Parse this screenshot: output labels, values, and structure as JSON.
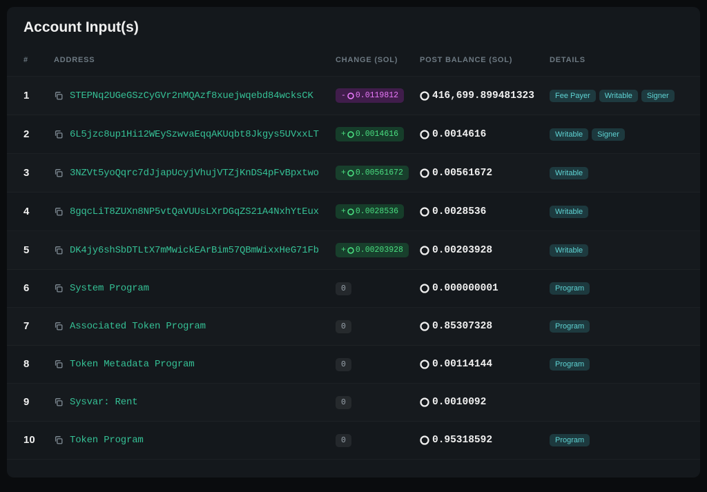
{
  "title": "Account Input(s)",
  "columns": {
    "index": "#",
    "address": "ADDRESS",
    "change": "CHANGE (SOL)",
    "post_balance": "POST BALANCE (SOL)",
    "details": "DETAILS"
  },
  "tags": {
    "fee_payer": "Fee Payer",
    "writable": "Writable",
    "signer": "Signer",
    "program": "Program"
  },
  "rows": [
    {
      "idx": "1",
      "address": "STEPNq2UGeGSzCyGVr2nMQAzf8xuejwqebd84wcksCK",
      "change_sign": "-",
      "change_val": "0.0119812",
      "change_type": "neg",
      "post": "416,699.899481323",
      "details": [
        "fee_payer",
        "writable",
        "signer"
      ]
    },
    {
      "idx": "2",
      "address": "6L5jzc8up1Hi12WEySzwvaEqqAKUqbt8Jkgys5UVxxLT",
      "change_sign": "+",
      "change_val": "0.0014616",
      "change_type": "pos",
      "post": "0.0014616",
      "details": [
        "writable",
        "signer"
      ]
    },
    {
      "idx": "3",
      "address": "3NZVt5yoQqrc7dJjapUcyjVhujVTZjKnDS4pFvBpxtwo",
      "change_sign": "+",
      "change_val": "0.00561672",
      "change_type": "pos",
      "post": "0.00561672",
      "details": [
        "writable"
      ]
    },
    {
      "idx": "4",
      "address": "8gqcLiT8ZUXn8NP5vtQaVUUsLXrDGqZS21A4NxhYtEux",
      "change_sign": "+",
      "change_val": "0.0028536",
      "change_type": "pos",
      "post": "0.0028536",
      "details": [
        "writable"
      ]
    },
    {
      "idx": "5",
      "address": "DK4jy6shSbDTLtX7mMwickEArBim57QBmWixxHeG71Fb",
      "change_sign": "+",
      "change_val": "0.00203928",
      "change_type": "pos",
      "post": "0.00203928",
      "details": [
        "writable"
      ]
    },
    {
      "idx": "6",
      "address": "System Program",
      "change_sign": "",
      "change_val": "0",
      "change_type": "zero",
      "post": "0.000000001",
      "details": [
        "program"
      ]
    },
    {
      "idx": "7",
      "address": "Associated Token Program",
      "change_sign": "",
      "change_val": "0",
      "change_type": "zero",
      "post": "0.85307328",
      "details": [
        "program"
      ]
    },
    {
      "idx": "8",
      "address": "Token Metadata Program",
      "change_sign": "",
      "change_val": "0",
      "change_type": "zero",
      "post": "0.00114144",
      "details": [
        "program"
      ]
    },
    {
      "idx": "9",
      "address": "Sysvar: Rent",
      "change_sign": "",
      "change_val": "0",
      "change_type": "zero",
      "post": "0.0010092",
      "details": []
    },
    {
      "idx": "10",
      "address": "Token Program",
      "change_sign": "",
      "change_val": "0",
      "change_type": "zero",
      "post": "0.95318592",
      "details": [
        "program"
      ]
    }
  ]
}
